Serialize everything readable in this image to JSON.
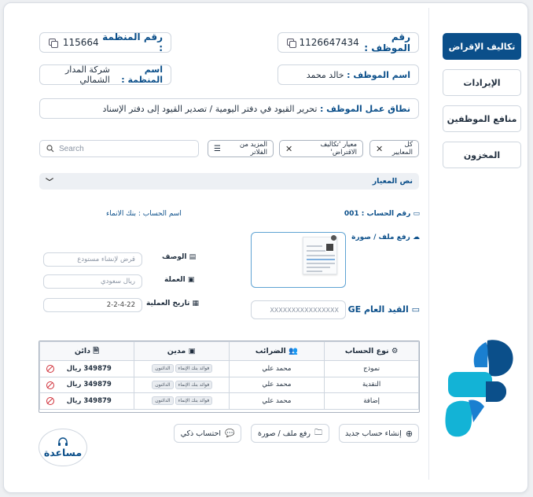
{
  "sidebar": {
    "items": [
      {
        "label": "تكاليف الإقراض",
        "active": true
      },
      {
        "label": "الإيرادات",
        "active": false
      },
      {
        "label": "منافع الموظفين",
        "active": false
      },
      {
        "label": "المخزون",
        "active": false
      }
    ]
  },
  "header": {
    "employee_number_label": "رقم الموظف :",
    "employee_number": "1126647434",
    "org_number_label": "رقم المنظمة :",
    "org_number": "115664",
    "employee_name_label": "اسم الموظف :",
    "employee_name": "خالد محمد",
    "org_name_label": "اسم المنظمة :",
    "org_name": "شركة المدار الشمالي",
    "scope_label": "نطاق عمل الموظف :",
    "scope_value": "تحرير القيود في دفتر اليومية / تصدير القيود إلى دفتر الإسناد"
  },
  "filters": {
    "chips": [
      "كل المعايير",
      "معيار 'تكاليف الاقتراض'"
    ],
    "more_label": "المزيد من الفلاتر",
    "search_placeholder": "Search"
  },
  "criteria_bar": {
    "label": "نص المعيار"
  },
  "account": {
    "number_label": "رقم الحساب : 001",
    "name_label": "اسم الحساب : بنك الانماء",
    "upload_label": "رفع ملف / صورة",
    "description_label": "الوصف",
    "description_placeholder": "قرض لإنشاء مستودع",
    "currency_label": "العملة",
    "currency_placeholder": "ريال سعودي",
    "date_label": "تاريخ العملية",
    "date_value": "2-2-4-22",
    "ge_label": "القيد العام GE",
    "ge_placeholder": "XXXXXXXXXXXXXXXX"
  },
  "table": {
    "headers": [
      "نوع الحساب",
      "الضرائب",
      "مدين",
      "دائن"
    ],
    "rows": [
      {
        "type": "نموذج",
        "tax": "محمد علي",
        "tags": [
          "فوائد بنك الإنماء",
          "الدائنون"
        ],
        "credit": "349879 ريال"
      },
      {
        "type": "النقدية",
        "tax": "محمد علي",
        "tags": [
          "فوائد بنك الإنماء",
          "الدائنون"
        ],
        "credit": "349879 ريال"
      },
      {
        "type": "إضافة",
        "tax": "محمد علي",
        "tags": [
          "فوائد بنك الإنماء",
          "الدائنون"
        ],
        "credit": "349879 ريال"
      }
    ]
  },
  "actions": {
    "new_account": "إنشاء حساب جديد",
    "upload": "رفع ملف / صورة",
    "smart_calc": "احتساب ذكي"
  },
  "help": {
    "label": "مساعدة"
  },
  "colors": {
    "primary": "#0b4f8a",
    "accent": "#1a7fd0",
    "brand_light": "#13b3d6",
    "danger": "#d0303a"
  }
}
